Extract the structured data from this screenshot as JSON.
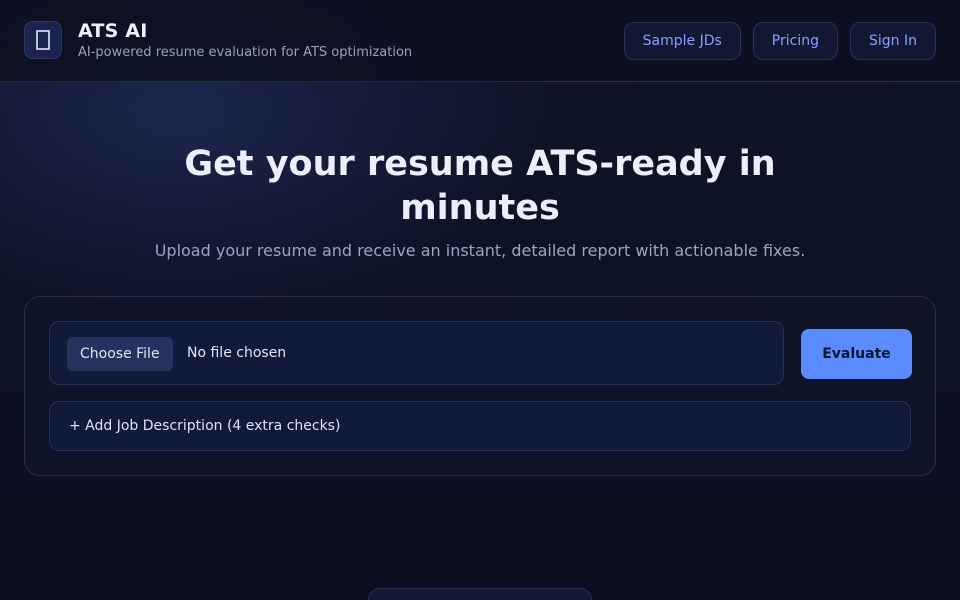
{
  "header": {
    "logo_icon": "document-icon",
    "title": "ATS AI",
    "subtitle": "AI-powered resume evaluation for ATS optimization",
    "nav": [
      {
        "label": "Sample JDs"
      },
      {
        "label": "Pricing"
      },
      {
        "label": "Sign In"
      }
    ]
  },
  "hero": {
    "title_line1": "Get your resume ATS-ready in",
    "title_line2": "minutes",
    "subtitle": "Upload your resume and receive an instant, detailed report with actionable fixes."
  },
  "upload": {
    "choose_label": "Choose File",
    "file_status": "No file chosen",
    "evaluate_label": "Evaluate",
    "add_jd_label": "+ Add Job Description (4 extra checks)"
  },
  "colors": {
    "accent": "#5b8cff",
    "nav_text": "#86a2ff",
    "background": "#0c1020"
  }
}
